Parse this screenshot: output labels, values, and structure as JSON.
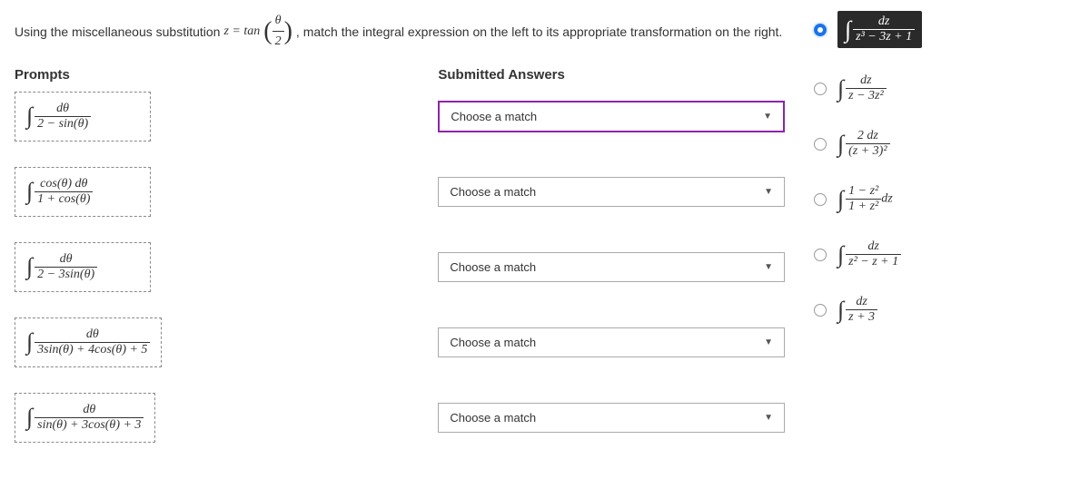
{
  "instruction_part1": "Using the miscellaneous substitution ",
  "instruction_sub_lhs": "z = tan",
  "instruction_frac_num": "θ",
  "instruction_frac_den": "2",
  "instruction_part2": ", match the integral expression on the left to its appropriate transformation on the right.",
  "headers": {
    "prompts": "Prompts",
    "submitted": "Submitted Answers"
  },
  "select_placeholder": "Choose a match",
  "prompts": [
    {
      "num": "dθ",
      "den": "2 − sin(θ)"
    },
    {
      "num": "cos(θ) dθ",
      "den": "1 + cos(θ)"
    },
    {
      "num": "dθ",
      "den": "2 − 3sin(θ)"
    },
    {
      "num": "dθ",
      "den": "3sin(θ) + 4cos(θ) + 5"
    },
    {
      "num": "dθ",
      "den": "sin(θ) + 3cos(θ) + 3"
    }
  ],
  "choices": [
    {
      "num": "dz",
      "den": "z³ − 3z + 1",
      "selected": true,
      "trail": ""
    },
    {
      "num": "dz",
      "den": "z − 3z²",
      "selected": false,
      "trail": ""
    },
    {
      "num": "2 dz",
      "den": "(z + 3)²",
      "selected": false,
      "trail": ""
    },
    {
      "num": "1 − z²",
      "den": "1 + z²",
      "selected": false,
      "trail": "dz"
    },
    {
      "num": "dz",
      "den": "z² − z + 1",
      "selected": false,
      "trail": ""
    },
    {
      "num": "dz",
      "den": "z + 3",
      "selected": false,
      "trail": ""
    }
  ]
}
